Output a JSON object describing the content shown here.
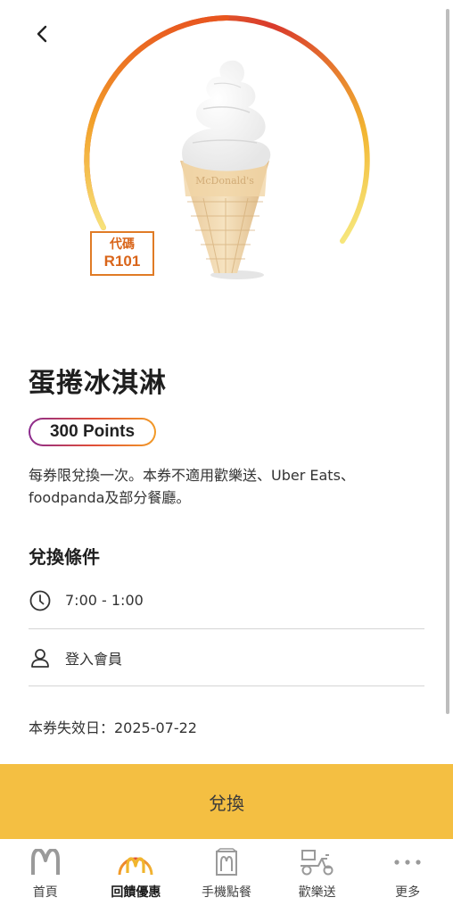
{
  "header": {
    "back_icon": "chevron-left-icon"
  },
  "product": {
    "image": "soft-serve-cone-image",
    "code_label": "代碼",
    "code_value": "R101",
    "name": "蛋捲冰淇淋",
    "points_label": "300 Points",
    "description": "每券限兌換一次。本券不適用歡樂送、Uber Eats、foodpanda及部分餐廳。"
  },
  "conditions": {
    "title": "兌換條件",
    "items": [
      {
        "icon": "clock-icon",
        "text": "7:00 - 1:00"
      },
      {
        "icon": "user-icon",
        "text": "登入會員"
      }
    ]
  },
  "expiry": {
    "text": "本券失效日：2025-07-22"
  },
  "redeem_button": {
    "label": "兌換"
  },
  "tabbar": {
    "items": [
      {
        "label": "首頁",
        "icon": "golden-arches-icon",
        "active": false
      },
      {
        "label": "回饋優惠",
        "icon": "rewards-arch-icon",
        "active": true
      },
      {
        "label": "手機點餐",
        "icon": "mobile-order-bag-icon",
        "active": false
      },
      {
        "label": "歡樂送",
        "icon": "delivery-scooter-icon",
        "active": false
      },
      {
        "label": "更多",
        "icon": "more-dots-icon",
        "active": false
      }
    ]
  },
  "colors": {
    "accent_yellow": "#f4bf42",
    "code_orange": "#e07b25",
    "ring_red": "#d9362b",
    "ring_yellow": "#f6ec7a"
  }
}
